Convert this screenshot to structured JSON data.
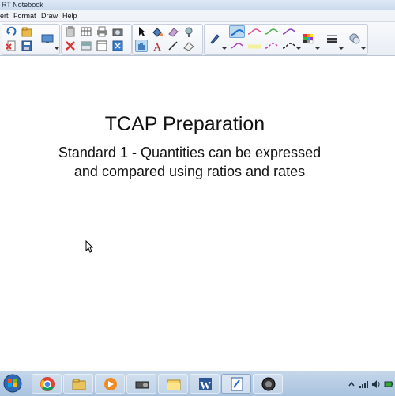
{
  "window": {
    "title": "RT Notebook"
  },
  "menu": {
    "items": [
      "ert",
      "Format",
      "Draw",
      "Help"
    ]
  },
  "toolbar": {
    "groups": {
      "file_icons": [
        "redo-icon",
        "open-file-icon",
        "delete-page-icon",
        "save-icon",
        "display-icon"
      ],
      "edit_icons": [
        "paste-icon",
        "table-icon",
        "print-icon",
        "camera-icon",
        "delete-icon",
        "screen-shade-icon",
        "full-screen-icon",
        "capture-icon"
      ],
      "tool_icons": [
        "select-arrow-icon",
        "fill-icon",
        "eraser-icon",
        "magic-wand-icon",
        "touch-icon",
        "text-icon",
        "line-icon",
        "shape-eraser-icon"
      ],
      "pen_icons": [
        "pen-icon",
        "pen-style-blue",
        "pen-style-pink",
        "pen-style-green",
        "pen-style-purple",
        "pen-style-purple-2",
        "pen-style-yellow",
        "pen-style-magenta",
        "pen-style-black",
        "color-palette-icon",
        "line-properties-icon",
        "fill-effect-icon"
      ]
    },
    "accent": "#6ea4d6"
  },
  "canvas": {
    "title": "TCAP Preparation",
    "subtitle_line1": "Standard 1 - Quantities can be expressed",
    "subtitle_line2": "and compared using ratios and rates"
  },
  "taskbar": {
    "start": "windows-orb-icon",
    "items": [
      {
        "name": "chrome-icon",
        "state": "pinned"
      },
      {
        "name": "explorer-folder-icon",
        "state": "pinned"
      },
      {
        "name": "media-player-icon",
        "state": "pinned"
      },
      {
        "name": "projector-icon",
        "state": "pinned"
      },
      {
        "name": "folder-icon",
        "state": "pinned"
      },
      {
        "name": "word-icon",
        "state": "pinned"
      },
      {
        "name": "notebook-icon",
        "state": "running"
      },
      {
        "name": "recorder-icon",
        "state": "pinned"
      }
    ],
    "tray": [
      "tray-arrow-icon",
      "network-icon",
      "volume-icon",
      "power-icon"
    ]
  }
}
